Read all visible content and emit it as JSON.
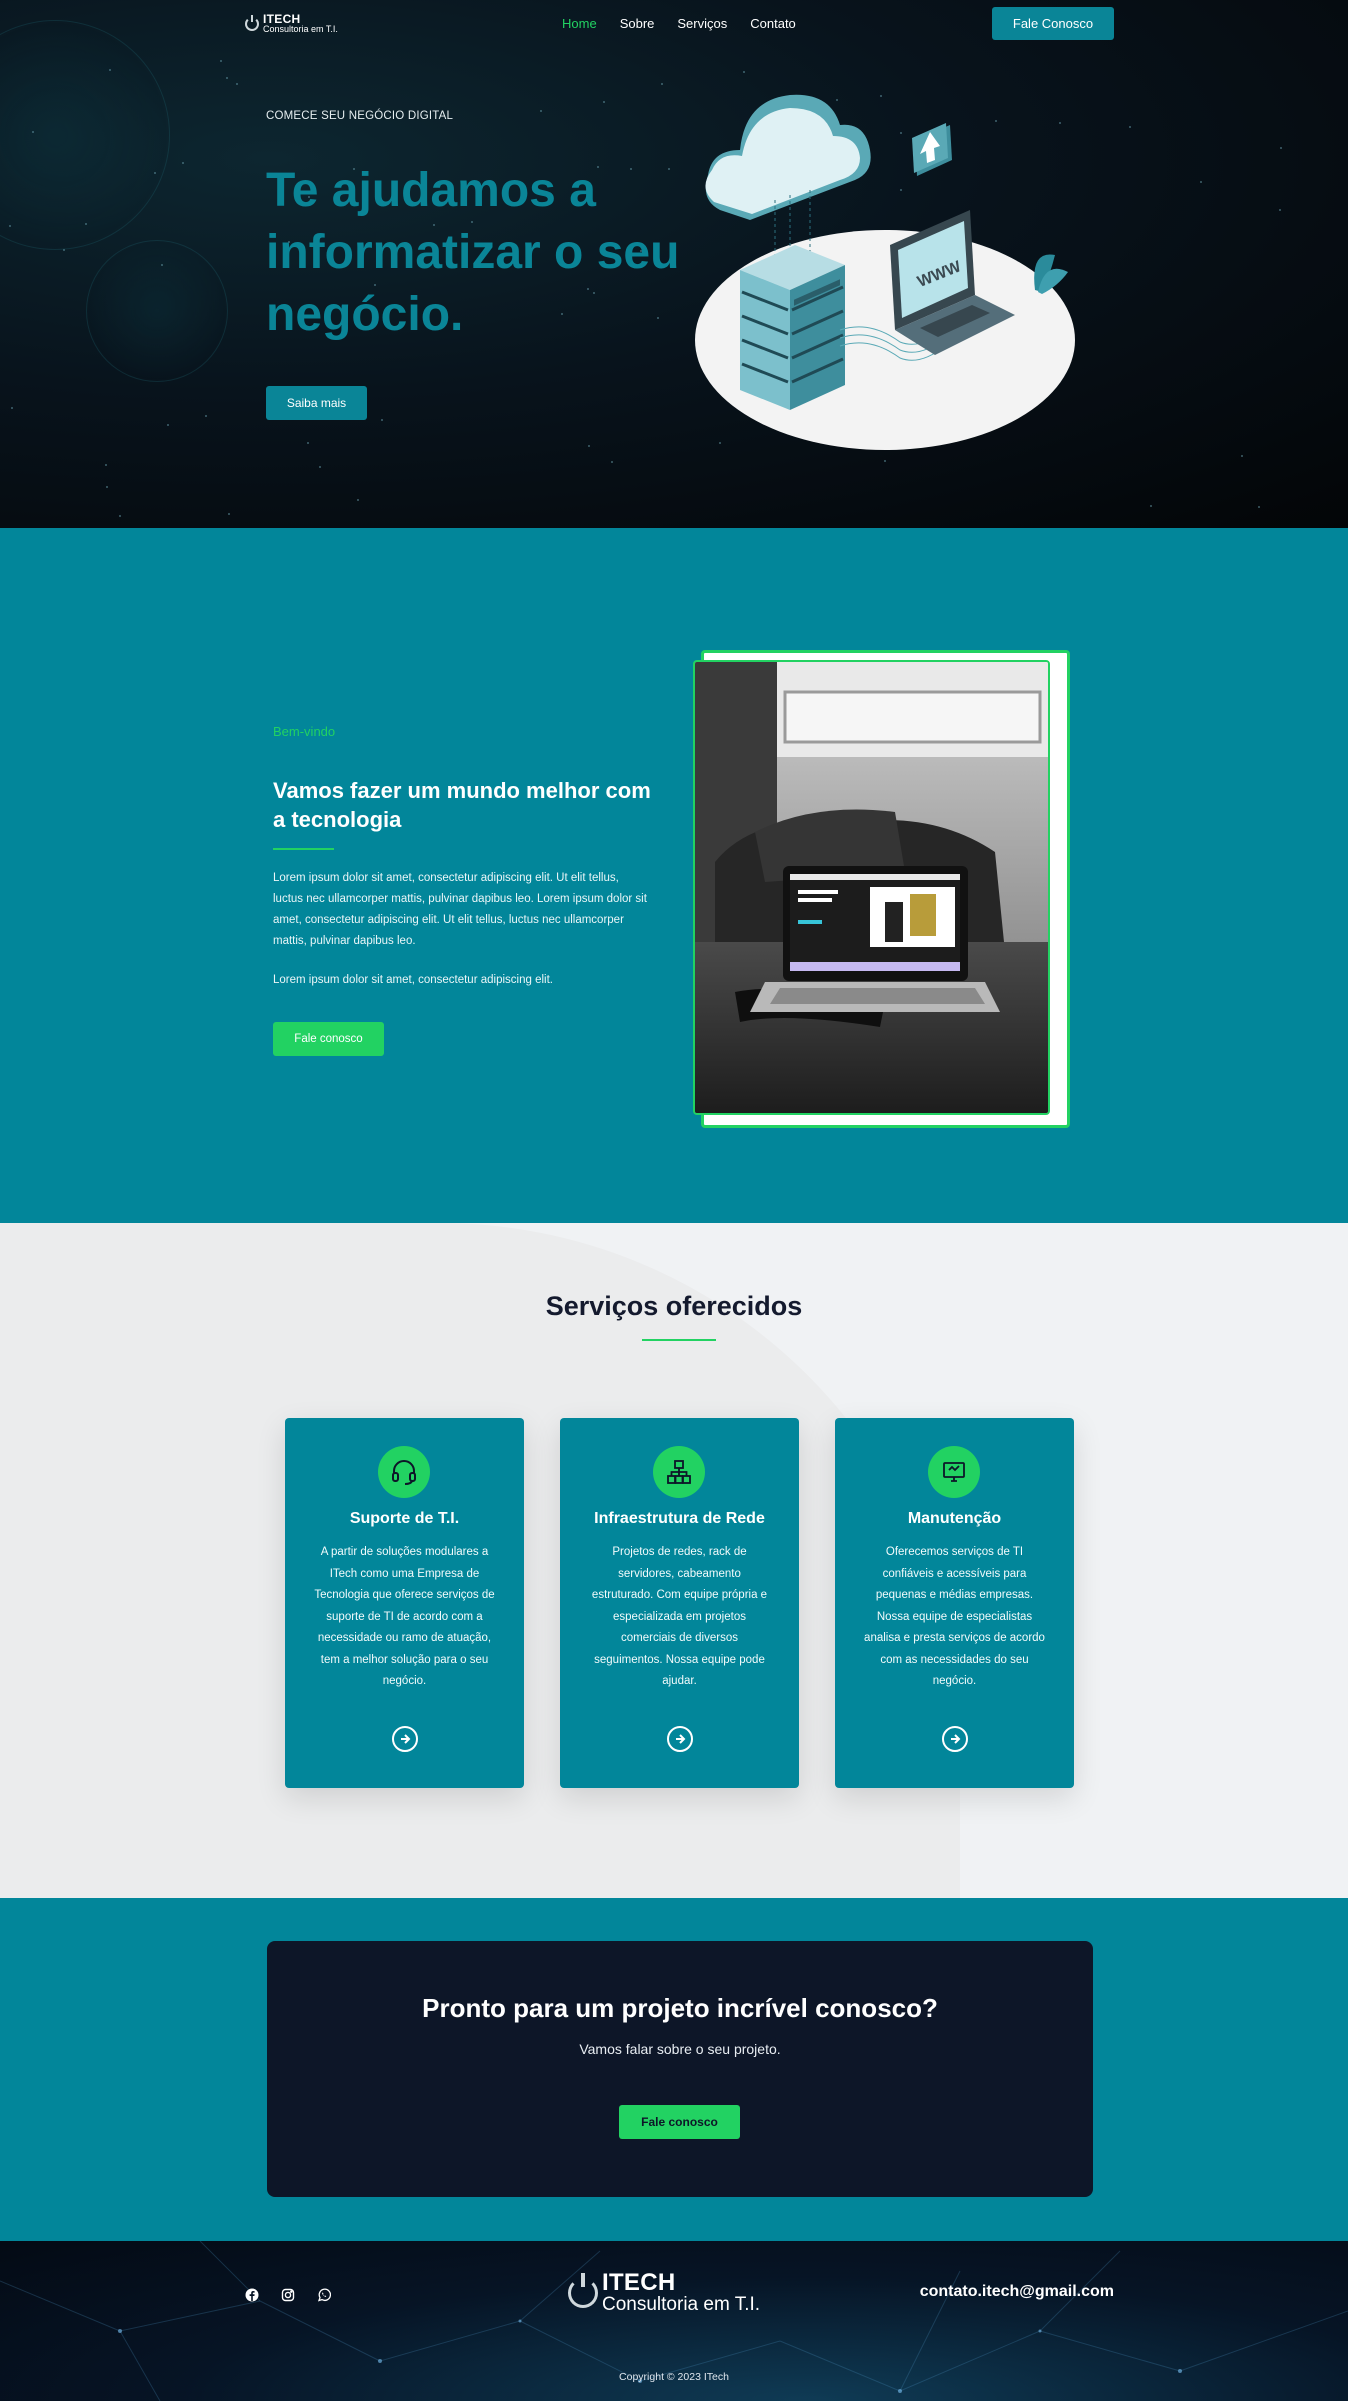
{
  "brand": {
    "name": "ITECH",
    "tagline": "Consultoria em T.I."
  },
  "nav": {
    "items": [
      {
        "label": "Home",
        "active": true
      },
      {
        "label": "Sobre",
        "active": false
      },
      {
        "label": "Serviços",
        "active": false
      },
      {
        "label": "Contato",
        "active": false
      }
    ],
    "cta_label": "Fale Conosco"
  },
  "hero": {
    "kicker": "COMECE SEU NEGÓCIO DIGITAL",
    "headline": "Te ajudamos a informatizar o seu negócio.",
    "button_label": "Saiba mais",
    "laptop_screen_text": "WWW"
  },
  "about": {
    "eyebrow": "Bem-vindo",
    "title": "Vamos fazer um mundo melhor com a tecnologia",
    "paragraph_1": "Lorem ipsum dolor sit amet, consectetur adipiscing elit. Ut elit tellus, luctus nec ullamcorper mattis, pulvinar dapibus leo. Lorem ipsum dolor sit amet, consectetur adipiscing elit. Ut elit tellus, luctus nec ullamcorper mattis, pulvinar dapibus leo.",
    "paragraph_2": "Lorem ipsum dolor sit amet, consectetur adipiscing elit.",
    "button_label": "Fale conosco"
  },
  "services": {
    "title": "Serviços oferecidos",
    "cards": [
      {
        "icon": "headset-icon",
        "title": "Suporte de T.I.",
        "text": "A partir de soluções modulares a ITech como uma Empresa de Tecnologia que oferece serviços de suporte de TI de acordo com a necessidade ou ramo de atuação, tem a melhor solução para o seu negócio."
      },
      {
        "icon": "network-icon",
        "title": "Infraestrutura de Rede",
        "text": "Projetos de redes, rack de servidores, cabeamento estruturado. Com equipe própria e especializada em projetos comerciais de diversos seguimentos. Nossa equipe pode ajudar."
      },
      {
        "icon": "monitor-icon",
        "title": "Manutenção",
        "text": "Oferecemos serviços de TI confiáveis e acessíveis para pequenas e médias empresas. Nossa equipe de especialistas analisa e presta serviços de acordo com as necessidades do seu negócio."
      }
    ]
  },
  "cta_band": {
    "title": "Pronto para um projeto incrível conosco?",
    "subtitle": "Vamos falar sobre o seu projeto.",
    "button_label": "Fale conosco"
  },
  "footer": {
    "social": [
      "facebook-icon",
      "instagram-icon",
      "whatsapp-icon"
    ],
    "email": "contato.itech@gmail.com",
    "copyright": "Copyright © 2023 ITech"
  },
  "colors": {
    "accent": "#02869a",
    "green": "#22d262",
    "dark": "#0d1628",
    "light": "#f0f2f4"
  }
}
